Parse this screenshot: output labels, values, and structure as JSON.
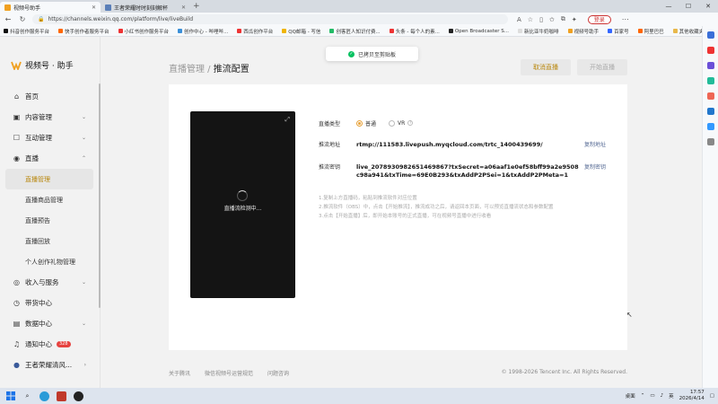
{
  "browser": {
    "tabs": [
      {
        "title": "视频号助手",
        "active": true
      },
      {
        "title": "王者荣耀时时刻刻解杯",
        "active": false
      }
    ],
    "new_tab": "+",
    "url": "https://channels.weixin.qq.com/platform/live/liveBuild",
    "login_label": "登录",
    "bookmarks": [
      "抖音创作服务平台",
      "快手创作者服务平台",
      "小红书创作服务平台",
      "创作中心 - 哔哩哔...",
      "西瓜创作平台",
      "QQ邮箱 - 写信",
      "创客匠人知识付费...",
      "头条 - 每个人的素...",
      "Open Broadcaster S...",
      "新比亚牛奶咖啡",
      "视频号助手",
      "百家号",
      "阿里巴巴"
    ],
    "bookmarks_right": "其他收藏夹"
  },
  "app": {
    "logo_text": "视频号 · 助手",
    "nav": [
      {
        "label": "首页",
        "icon": "home-icon",
        "glyph": "⌂"
      },
      {
        "label": "内容管理",
        "icon": "content-icon",
        "glyph": "▣",
        "chevron": "⌄"
      },
      {
        "label": "互动管理",
        "icon": "interaction-icon",
        "glyph": "☐",
        "chevron": "⌄"
      },
      {
        "label": "直播",
        "icon": "live-icon",
        "glyph": "◉",
        "chevron": "⌃"
      }
    ],
    "live_sub": [
      "直播管理",
      "直播商品管理",
      "直播预告",
      "直播回放",
      "个人创作礼物管理"
    ],
    "nav_bottom": [
      {
        "label": "收入与服务",
        "icon": "income-icon",
        "glyph": "◎",
        "chevron": "⌄"
      },
      {
        "label": "带货中心",
        "icon": "goods-icon",
        "glyph": "◷"
      },
      {
        "label": "数据中心",
        "icon": "data-icon",
        "glyph": "▤",
        "chevron": "⌄"
      },
      {
        "label": "通知中心",
        "icon": "bell-icon",
        "glyph": "♫",
        "badge": "328"
      },
      {
        "label": "王者荣耀清风...",
        "icon": "avatar-icon",
        "glyph": "●",
        "chevron": "›"
      }
    ]
  },
  "page": {
    "breadcrumb_parent": "直播管理",
    "breadcrumb_sep": " / ",
    "breadcrumb_current": "推流配置",
    "cancel_label": "取消直播",
    "start_label": "开始直播",
    "toast": "已拷贝至剪贴板",
    "preview_status": "直播流检测中...",
    "type_label": "直播类型",
    "type_options": [
      "普通",
      "VR"
    ],
    "addr_label": "推流地址",
    "addr_value": "rtmp://111583.livepush.myqcloud.com/trtc_1400439699/",
    "addr_copy": "复制地址",
    "key_label": "推流密钥",
    "key_value": "live_207893098265146986​7?txSecret=a06aaf1e0ef58bff99a2e9508c98a941&txTime=69E0B293&txAddP2PSei=1&txAddP2PMeta=1",
    "key_copy": "复制密钥",
    "notes": [
      "1.复制上方直播码，粘贴到推流软件对应位置",
      "2.推流软件（OBS）中，点击【开始推流】，推流成功之后，请返回本页面，可以预览直播流状态和参数配置",
      "3.点击【开始直播】后，即开始本账号的正式直播，可在视频号直播中进行收看"
    ],
    "footer_links": [
      "关于腾讯",
      "微信视频号运营规范",
      "问题咨询"
    ],
    "copyright": "© 1998-2026 Tencent Inc. All Rights Reserved."
  },
  "taskbar": {
    "tray_label": "桌面",
    "ime": "英",
    "time": "17:57",
    "date": "2026/4/14"
  },
  "colors": {
    "accent": "#b8860b",
    "link": "#576b95",
    "toast_ok": "#07c160",
    "badge": "#e64340"
  }
}
